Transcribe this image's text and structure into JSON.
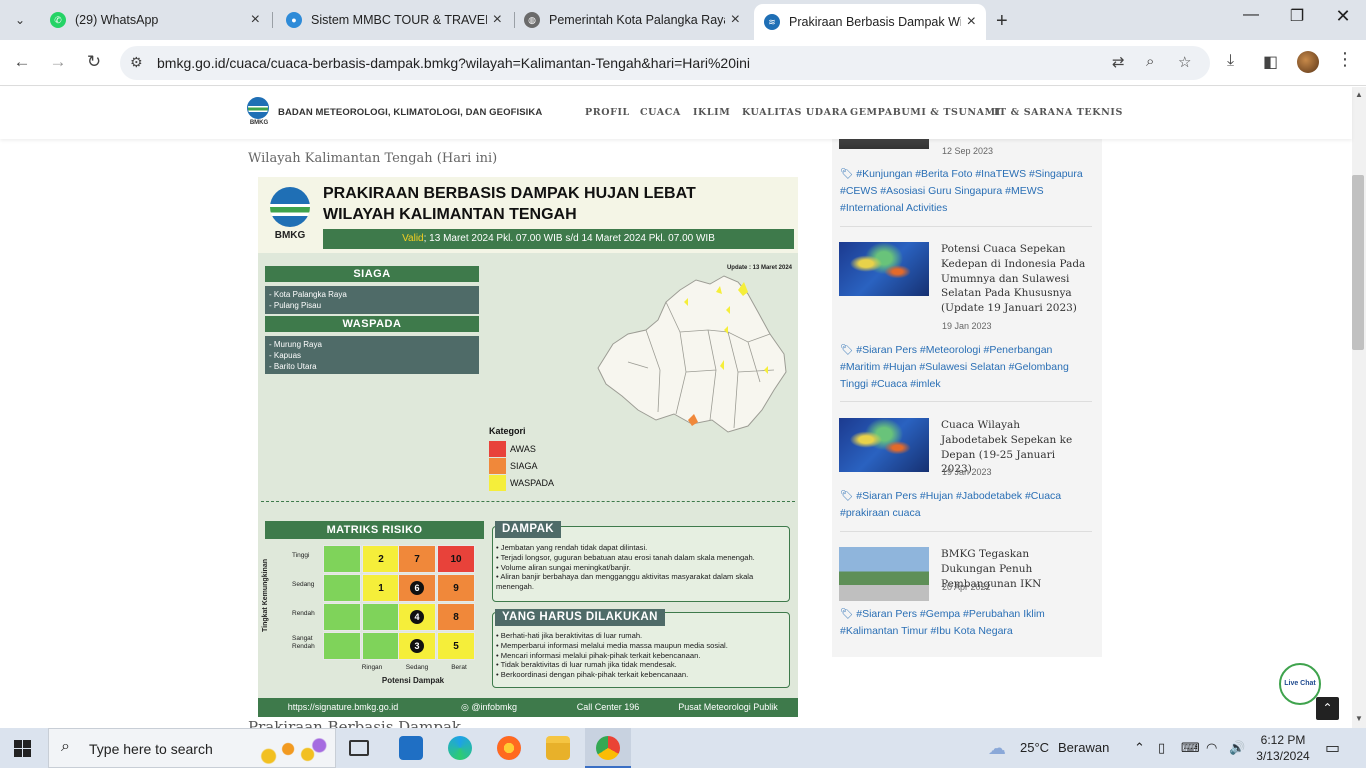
{
  "browser": {
    "tabs": [
      {
        "title": "(29) WhatsApp",
        "badge": "29",
        "favicon_color": "#25d366"
      },
      {
        "title": "Sistem MMBC TOUR & TRAVEL",
        "favicon_color": "#2e8bd8"
      },
      {
        "title": "Pemerintah Kota Palangka Raya",
        "favicon_color": "#6b6b6b"
      },
      {
        "title": "Prakiraan Berbasis Dampak Wilayah",
        "favicon_color": "#1f6fb5"
      }
    ],
    "url": "bmkg.go.id/cuaca/cuaca-berbasis-dampak.bmkg?wilayah=Kalimantan-Tengah&hari=Hari%20ini"
  },
  "site": {
    "logo_text": "BMKG",
    "title": "BADAN METEOROLOGI, KLIMATOLOGI, DAN GEOFISIKA",
    "menu": [
      "PROFIL",
      "CUACA",
      "IKLIM",
      "KUALITAS UDARA",
      "GEMPABUMI & TSUNAMI",
      "IT & SARANA TEKNIS"
    ]
  },
  "main": {
    "region_heading": "Wilayah Kalimantan Tengah (Hari ini)",
    "next_heading": "Prakiraan Berbasis Dampak"
  },
  "infographic": {
    "logo_text": "BMKG",
    "title_line1": "PRAKIRAAN BERBASIS DAMPAK HUJAN LEBAT",
    "title_line2": "WILAYAH KALIMANTAN TENGAH",
    "valid_label": "Valid",
    "valid_text": "; 13 Maret 2024 Pkl. 07.00 WIB s/d 14 Maret 2024 Pkl. 07.00 WIB",
    "update": "Update : 13 Maret 2024",
    "siaga": {
      "label": "SIAGA",
      "items": [
        "- Kota Palangka Raya",
        "- Pulang Pisau"
      ]
    },
    "waspada": {
      "label": "WASPADA",
      "items": [
        "- Murung Raya",
        "- Kapuas",
        "- Barito Utara"
      ]
    },
    "legend": {
      "title": "Kategori",
      "items": [
        {
          "label": "AWAS",
          "color": "#e8423a"
        },
        {
          "label": "SIAGA",
          "color": "#f0883a"
        },
        {
          "label": "WASPADA",
          "color": "#f5ee3a"
        }
      ]
    },
    "matrix": {
      "title": "MATRIKS RISIKO",
      "y_axis": "Tingkat Kemungkinan",
      "x_axis": "Potensi Dampak",
      "row_labels": [
        "Tinggi",
        "Sedang",
        "Rendah",
        "Sangat Rendah"
      ],
      "col_labels": [
        "",
        "Ringan",
        "Sedang",
        "Berat"
      ],
      "cells": [
        [
          "",
          "2",
          "7",
          "10"
        ],
        [
          "",
          "1",
          "6",
          "9"
        ],
        [
          "",
          "",
          "4",
          "8"
        ],
        [
          "",
          "",
          "3",
          "5"
        ]
      ],
      "cell_colors": [
        [
          "#7fd35a",
          "#f5ee3a",
          "#f0883a",
          "#e8423a"
        ],
        [
          "#7fd35a",
          "#f5ee3a",
          "#f0883a",
          "#f0883a"
        ],
        [
          "#7fd35a",
          "#7fd35a",
          "#f5ee3a",
          "#f0883a"
        ],
        [
          "#7fd35a",
          "#7fd35a",
          "#f5ee3a",
          "#f5ee3a"
        ]
      ],
      "circled": [
        "6",
        "4",
        "3"
      ]
    },
    "dampak": {
      "title": "DAMPAK",
      "items": [
        "Jembatan yang rendah tidak dapat dilintasi.",
        "Terjadi longsor, guguran bebatuan atau erosi tanah dalam skala menengah.",
        "Volume aliran sungai meningkat/banjir.",
        "Aliran banjir berbahaya dan mengganggu aktivitas masyarakat dalam skala menengah."
      ]
    },
    "actions": {
      "title": "YANG HARUS DILAKUKAN",
      "items": [
        "Berhati-hati jika beraktivitas di luar rumah.",
        "Memperbarui informasi melalui media massa maupun media sosial.",
        "Mencari informasi melalui pihak-pihak terkait kebencanaan.",
        "Tidak beraktivitas di luar rumah jika tidak mendesak.",
        "Berkoordinasi dengan pihak-pihak terkait kebencanaan."
      ]
    },
    "footer": [
      "https://signature.bmkg.go.id",
      "@infobmkg",
      "Call Center 196",
      "Pusat Meteorologi Publik"
    ]
  },
  "sidebar": {
    "top": {
      "date": "12 Sep 2023",
      "tags": "#Kunjungan #Berita Foto #InaTEWS #Singapura #CEWS #Asosiasi Guru Singapura #MEWS #International Activities"
    },
    "articles": [
      {
        "title": "Potensi Cuaca Sepekan Kedepan di Indonesia Pada Umumnya dan Sulawesi Selatan Pada Khususnya (Update 19 Januari 2023)",
        "date": "19 Jan 2023",
        "tags": "#Siaran Pers #Meteorologi #Penerbangan #Maritim #Hujan #Sulawesi Selatan #Gelombang Tinggi #Cuaca #imlek"
      },
      {
        "title": "Cuaca Wilayah Jabodetabek Sepekan ke Depan (19-25 Januari 2023)",
        "date": "19 Jan 2023",
        "tags": "#Siaran Pers #Hujan #Jabodetabek #Cuaca #prakiraan cuaca"
      },
      {
        "title": "BMKG Tegaskan Dukungan Penuh Pembangunan IKN",
        "date": "20 Apr 2022",
        "tags": "#Siaran Pers #Gempa #Perubahan Iklim #Kalimantan Timur #Ibu Kota Negara"
      }
    ]
  },
  "livechat": "Live Chat",
  "taskbar": {
    "search_placeholder": "Type here to search",
    "weather_temp": "25°C",
    "weather_text": "Berawan",
    "time": "6:12 PM",
    "date": "3/13/2024"
  }
}
